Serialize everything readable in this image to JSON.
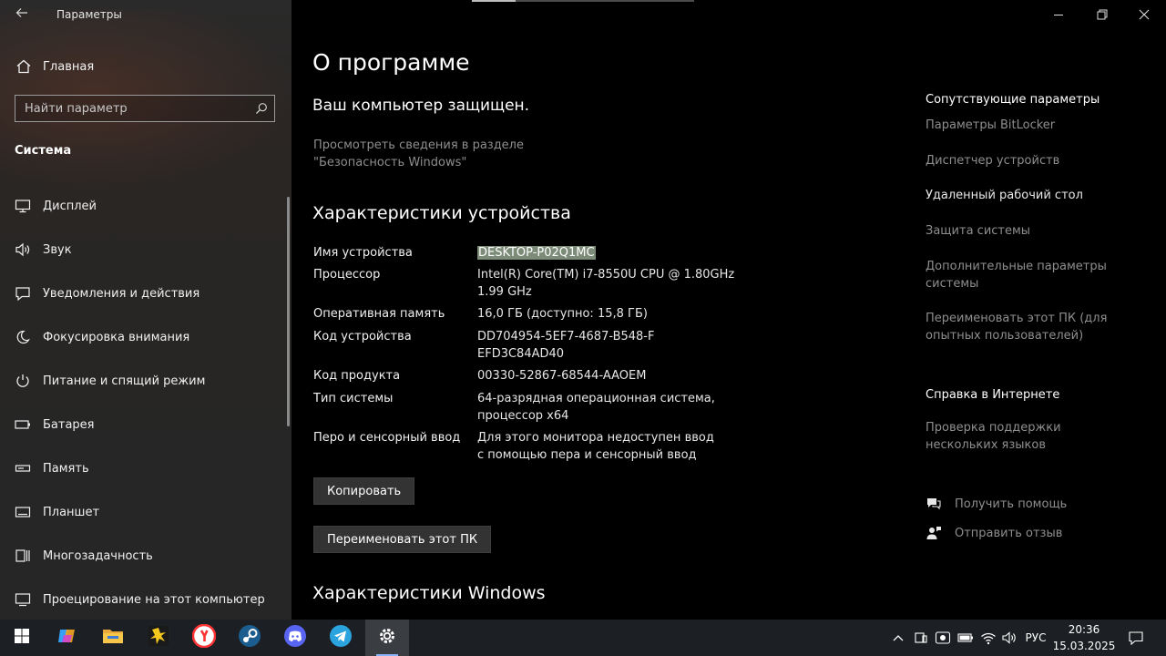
{
  "app": {
    "title": "Параметры"
  },
  "sidebar": {
    "home_label": "Главная",
    "search_placeholder": "Найти параметр",
    "section_title": "Система",
    "items": [
      {
        "label": "Дисплей",
        "icon": "monitor-icon"
      },
      {
        "label": "Звук",
        "icon": "speaker-icon"
      },
      {
        "label": "Уведомления и действия",
        "icon": "message-icon"
      },
      {
        "label": "Фокусировка внимания",
        "icon": "moon-icon"
      },
      {
        "label": "Питание и спящий режим",
        "icon": "power-icon"
      },
      {
        "label": "Батарея",
        "icon": "battery-icon"
      },
      {
        "label": "Память",
        "icon": "storage-icon"
      },
      {
        "label": "Планшет",
        "icon": "tablet-icon"
      },
      {
        "label": "Многозадачность",
        "icon": "multitask-icon"
      },
      {
        "label": "Проецирование на этот компьютер",
        "icon": "project-icon"
      }
    ]
  },
  "main": {
    "title": "О программе",
    "protected_text": "Ваш компьютер защищен.",
    "security_link": "Просмотреть сведения в разделе \"Безопасность Windows\"",
    "specs_title": "Характеристики устройства",
    "specs": [
      {
        "key": "Имя устройства",
        "value": "DESKTOP-P02Q1MC"
      },
      {
        "key": "Процессор",
        "value": "Intel(R) Core(TM) i7-8550U CPU @ 1.80GHz 1.99 GHz"
      },
      {
        "key": "Оперативная память",
        "value": "16,0 ГБ (доступно: 15,8 ГБ)"
      },
      {
        "key": "Код устройства",
        "value": "DD704954-5EF7-4687-B548-FEFD3C84AD40"
      },
      {
        "key": "Код продукта",
        "value": "00330-52867-68544-AAOEM"
      },
      {
        "key": "Тип системы",
        "value": "64-разрядная операционная система, процессор x64"
      },
      {
        "key": "Перо и сенсорный ввод",
        "value": "Для этого монитора недоступен ввод с помощью пера и сенсорный ввод"
      }
    ],
    "copy_button": "Копировать",
    "rename_button": "Переименовать этот ПК",
    "windows_title": "Характеристики Windows"
  },
  "related": {
    "title": "Сопутствующие параметры",
    "links": [
      "Параметры BitLocker",
      "Диспетчер устройств",
      "Удаленный рабочий стол",
      "Защита системы",
      "Дополнительные параметры системы",
      "Переименовать этот ПК (для опытных пользователей)"
    ],
    "web_help_title": "Справка в Интернете",
    "web_help_link": "Проверка поддержки нескольких языков",
    "get_help": "Получить помощь",
    "feedback": "Отправить отзыв"
  },
  "taskbar": {
    "apps": [
      "start-icon",
      "copilot-icon",
      "file-explorer-icon",
      "media-player-icon",
      "yandex-browser-icon",
      "steam-icon",
      "discord-icon",
      "telegram-icon",
      "settings-icon"
    ],
    "language": "РУС",
    "time": "20:36",
    "date": "15.03.2025"
  },
  "colors": {
    "sidebar_bg": "#2a2a2a",
    "main_bg": "#000000",
    "link_gray": "#8e8e8e",
    "highlight": "#7c8b78",
    "button_bg": "#333333",
    "taskbar_bg": "#1c1f23"
  }
}
